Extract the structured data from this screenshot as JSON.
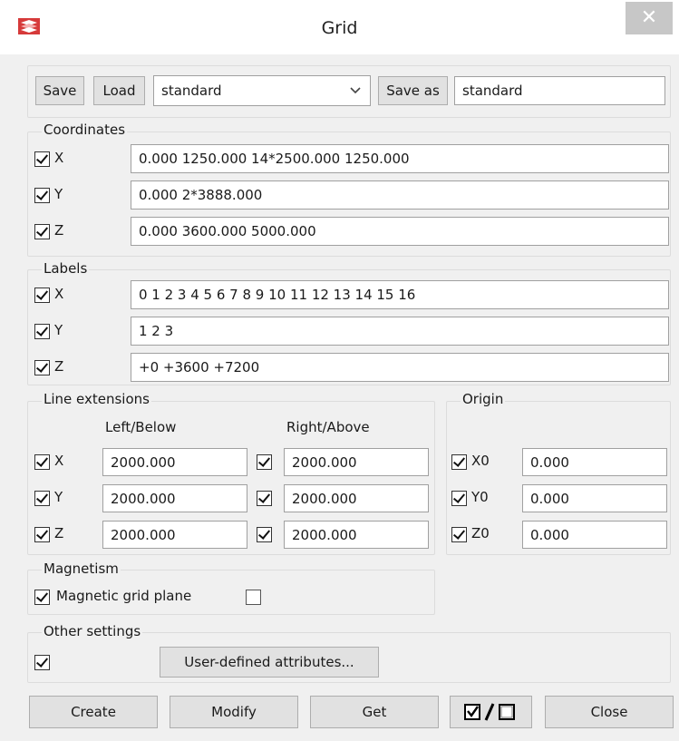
{
  "window": {
    "title": "Grid",
    "close_glyph": "✕",
    "app_icon": "app-logo-icon"
  },
  "toolbar": {
    "save_label": "Save",
    "load_label": "Load",
    "preset_value": "standard",
    "save_as_label": "Save as",
    "save_as_value": "standard"
  },
  "coordinates": {
    "label": "Coordinates",
    "rows": [
      {
        "axis": "X",
        "checked": true,
        "value": "0.000 1250.000 14*2500.000 1250.000"
      },
      {
        "axis": "Y",
        "checked": true,
        "value": "0.000 2*3888.000"
      },
      {
        "axis": "Z",
        "checked": true,
        "value": "0.000 3600.000 5000.000"
      }
    ]
  },
  "labels": {
    "label": "Labels",
    "rows": [
      {
        "axis": "X",
        "checked": true,
        "value": "0 1 2 3 4 5 6 7 8 9 10 11 12 13 14 15 16"
      },
      {
        "axis": "Y",
        "checked": true,
        "value": "1 2 3"
      },
      {
        "axis": "Z",
        "checked": true,
        "value": "+0 +3600 +7200"
      }
    ]
  },
  "line_extensions": {
    "label": "Line extensions",
    "left_header": "Left/Below",
    "right_header": "Right/Above",
    "rows": [
      {
        "axis": "X",
        "checked": true,
        "left": "2000.000",
        "right_checked": true,
        "right": "2000.000"
      },
      {
        "axis": "Y",
        "checked": true,
        "left": "2000.000",
        "right_checked": true,
        "right": "2000.000"
      },
      {
        "axis": "Z",
        "checked": true,
        "left": "2000.000",
        "right_checked": true,
        "right": "2000.000"
      }
    ]
  },
  "origin": {
    "label": "Origin",
    "rows": [
      {
        "axis": "X0",
        "checked": true,
        "value": "0.000"
      },
      {
        "axis": "Y0",
        "checked": true,
        "value": "0.000"
      },
      {
        "axis": "Z0",
        "checked": true,
        "value": "0.000"
      }
    ]
  },
  "magnetism": {
    "label": "Magnetism",
    "checkbox_checked": true,
    "item_label": "Magnetic grid plane",
    "value_checked": false
  },
  "other": {
    "label": "Other settings",
    "checked": true,
    "udattr_label": "User-defined attributes..."
  },
  "footer": {
    "create_label": "Create",
    "modify_label": "Modify",
    "get_label": "Get",
    "toggle_icon": "check-all-uncheck-all-icon",
    "close_label": "Close"
  }
}
